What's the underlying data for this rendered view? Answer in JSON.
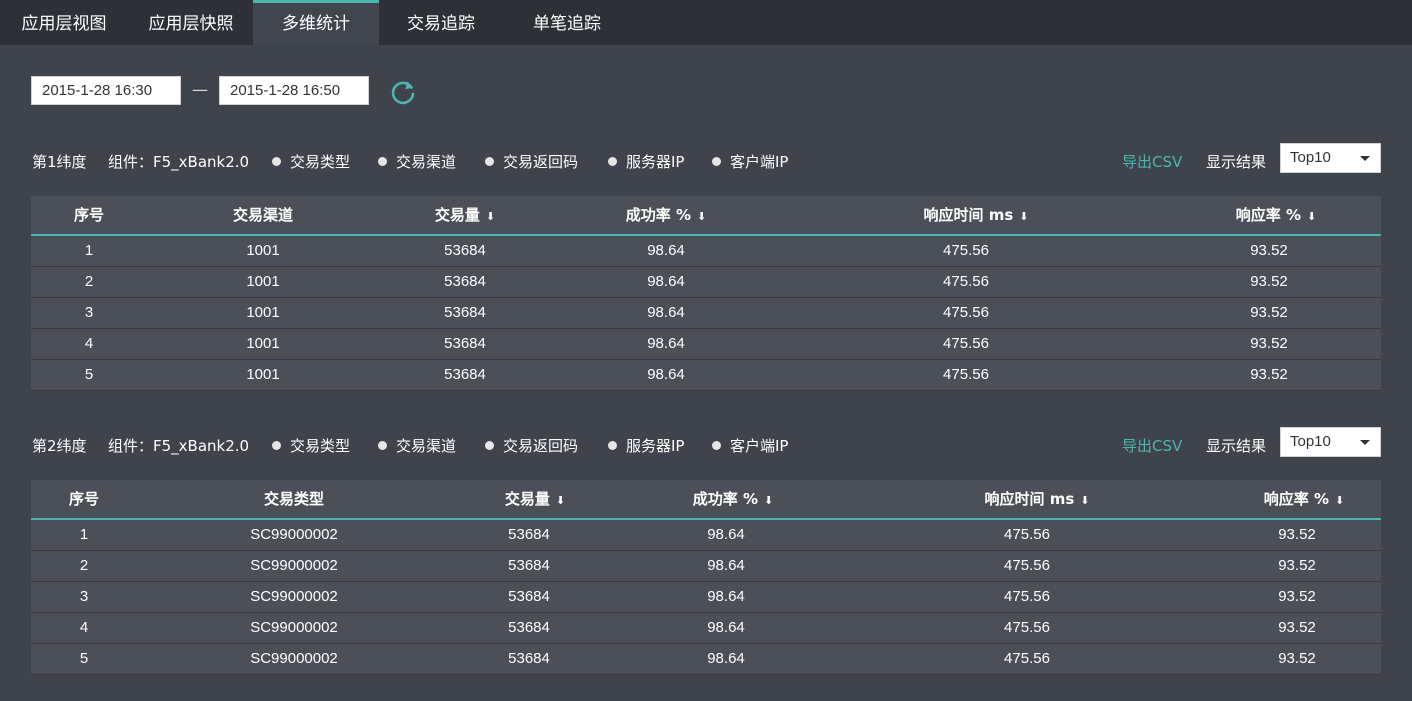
{
  "tabs": [
    {
      "label": "应用层视图",
      "active": false
    },
    {
      "label": "应用层快照",
      "active": false
    },
    {
      "label": "多维统计",
      "active": true
    },
    {
      "label": "交易追踪",
      "active": false
    },
    {
      "label": "单笔追踪",
      "active": false
    }
  ],
  "date_range": {
    "start": "2015-1-28 16:30",
    "separator": "—",
    "end": "2015-1-28 16:50",
    "refresh_icon": "refresh-icon"
  },
  "colors": {
    "accent": "#4db6ac",
    "background": "#3f434c",
    "topbar": "#2d3037",
    "table": "#4b4f58"
  },
  "dimensions": [
    {
      "label": "第1纬度",
      "component": "组件：F5_xBank2.0",
      "options": [
        "交易类型",
        "交易渠道",
        "交易返回码",
        "服务器IP",
        "客户端IP"
      ],
      "export": "导出CSV",
      "show_label": "显示结果",
      "show_value": "Top10",
      "columns": [
        "序号",
        "交易渠道",
        "交易量",
        "成功率 %",
        "响应时间 ms",
        "响应率 %"
      ],
      "sortable": [
        false,
        false,
        true,
        true,
        true,
        true
      ],
      "sort_icon": "⬇",
      "rows": [
        [
          "1",
          "1001",
          "53684",
          "98.64",
          "475.56",
          "93.52"
        ],
        [
          "2",
          "1001",
          "53684",
          "98.64",
          "475.56",
          "93.52"
        ],
        [
          "3",
          "1001",
          "53684",
          "98.64",
          "475.56",
          "93.52"
        ],
        [
          "4",
          "1001",
          "53684",
          "98.64",
          "475.56",
          "93.52"
        ],
        [
          "5",
          "1001",
          "53684",
          "98.64",
          "475.56",
          "93.52"
        ]
      ]
    },
    {
      "label": "第2纬度",
      "component": "组件：F5_xBank2.0",
      "options": [
        "交易类型",
        "交易渠道",
        "交易返回码",
        "服务器IP",
        "客户端IP"
      ],
      "export": "导出CSV",
      "show_label": "显示结果",
      "show_value": "Top10",
      "columns": [
        "序号",
        "交易类型",
        "交易量",
        "成功率 %",
        "响应时间 ms",
        "响应率 %"
      ],
      "sortable": [
        false,
        false,
        true,
        true,
        true,
        true
      ],
      "sort_icon": "⬇",
      "rows": [
        [
          "1",
          "SC99000002",
          "53684",
          "98.64",
          "475.56",
          "93.52"
        ],
        [
          "2",
          "SC99000002",
          "53684",
          "98.64",
          "475.56",
          "93.52"
        ],
        [
          "3",
          "SC99000002",
          "53684",
          "98.64",
          "475.56",
          "93.52"
        ],
        [
          "4",
          "SC99000002",
          "53684",
          "98.64",
          "475.56",
          "93.52"
        ],
        [
          "5",
          "SC99000002",
          "53684",
          "98.64",
          "475.56",
          "93.52"
        ]
      ]
    }
  ]
}
